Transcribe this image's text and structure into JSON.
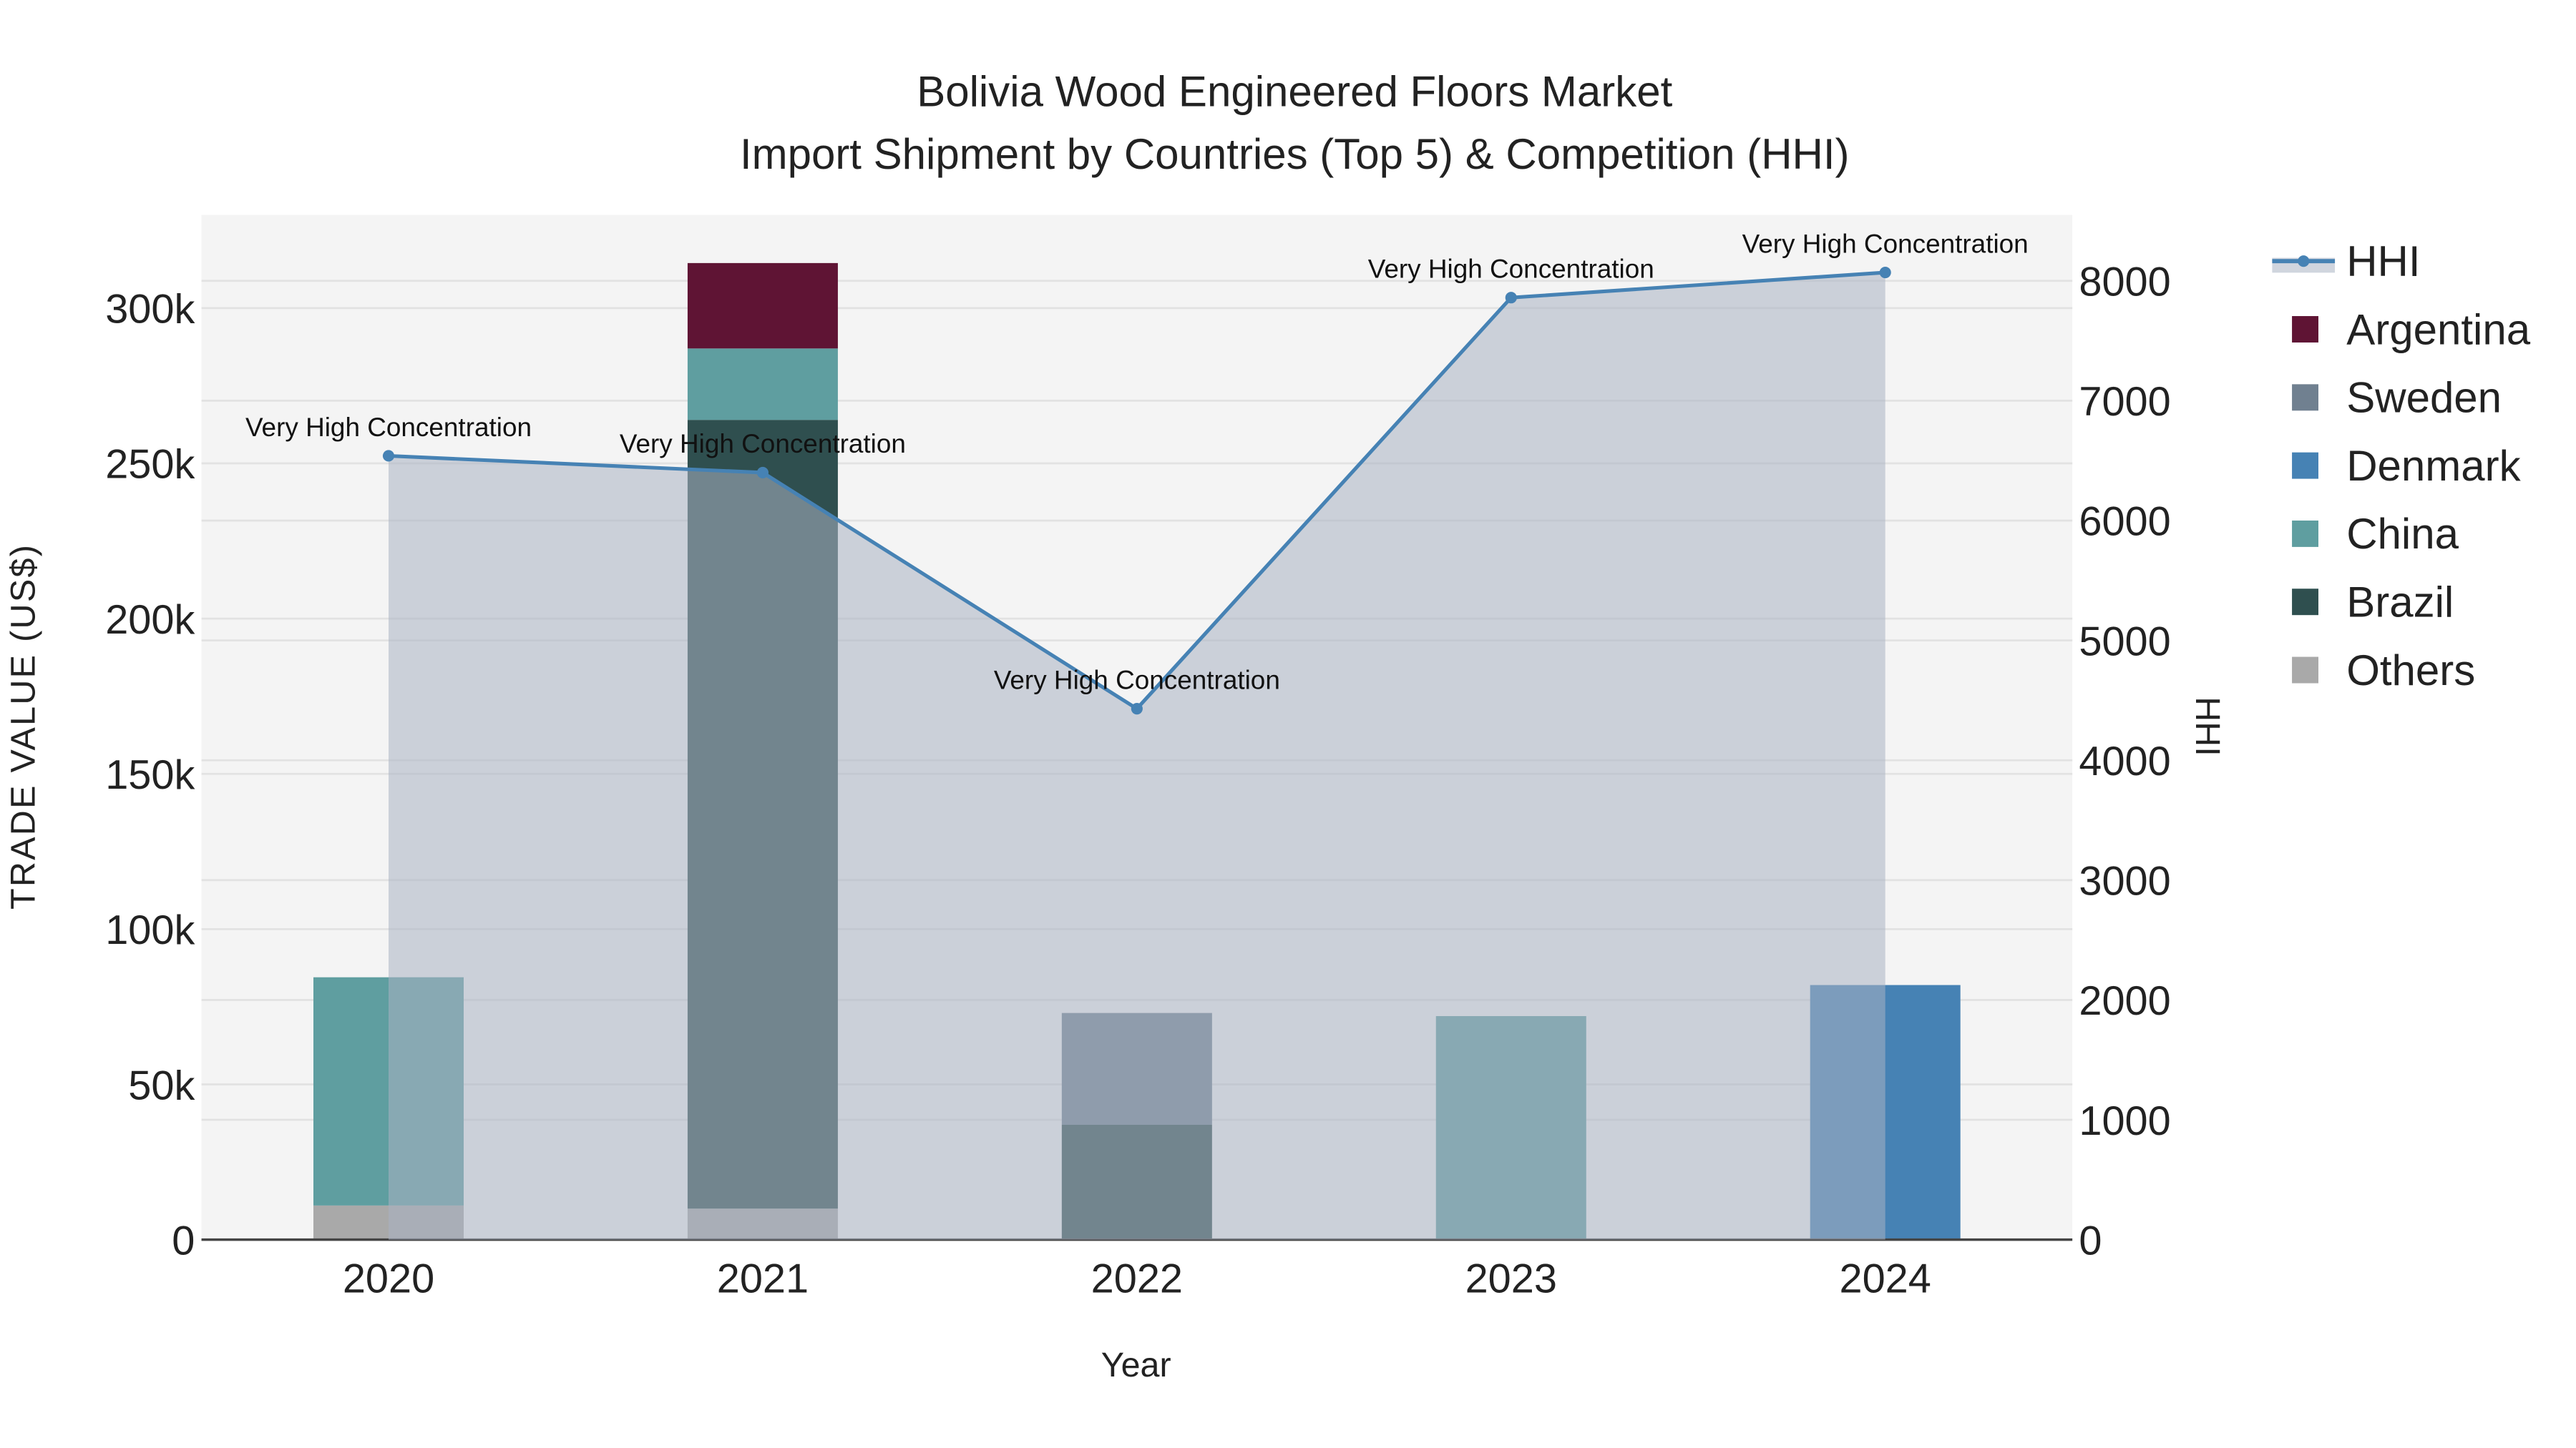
{
  "chart_data": {
    "type": "bar",
    "title": "Bolivia Wood Engineered Floors Market",
    "subtitle": "Import Shipment by Countries (Top 5) & Competition (HHI)",
    "xlabel": "Year",
    "ylabel": "TRADE VALUE (US$)",
    "y2label": "HHI",
    "categories": [
      "2020",
      "2021",
      "2022",
      "2023",
      "2024"
    ],
    "ylim": [
      0,
      330000
    ],
    "y2lim": [
      0,
      8550
    ],
    "yticks": [
      0,
      50000,
      100000,
      150000,
      200000,
      250000,
      300000
    ],
    "ytick_labels": [
      "0",
      "50k",
      "100k",
      "150k",
      "200k",
      "250k",
      "300k"
    ],
    "y2ticks": [
      0,
      1000,
      2000,
      3000,
      4000,
      5000,
      6000,
      7000,
      8000
    ],
    "y2tick_labels": [
      "0",
      "1000",
      "2000",
      "3000",
      "4000",
      "5000",
      "6000",
      "7000",
      "8000"
    ],
    "grid": true,
    "legend_position": "right",
    "series": [
      {
        "name": "Others",
        "color": "#a9a9a9",
        "values": [
          11000,
          10000,
          0,
          0,
          0
        ]
      },
      {
        "name": "Brazil",
        "color": "#2f4f4f",
        "values": [
          0,
          254000,
          37000,
          0,
          0
        ]
      },
      {
        "name": "China",
        "color": "#5f9ea0",
        "values": [
          73500,
          23000,
          0,
          72000,
          0
        ]
      },
      {
        "name": "Denmark",
        "color": "#4682b4",
        "values": [
          0,
          0,
          0,
          0,
          82000
        ]
      },
      {
        "name": "Sweden",
        "color": "#708090",
        "values": [
          0,
          0,
          36000,
          0,
          0
        ]
      },
      {
        "name": "Argentina",
        "color": "#5f1434",
        "values": [
          0,
          27500,
          0,
          0,
          0
        ]
      }
    ],
    "hhi": {
      "name": "HHI",
      "color": "#4682b4",
      "values": [
        6540,
        6400,
        4430,
        7860,
        8070
      ],
      "annotations": [
        "Very High Concentration",
        "Very High Concentration",
        "Very High Concentration",
        "Very High Concentration",
        "Very High Concentration"
      ]
    },
    "legend_order": [
      "HHI",
      "Argentina",
      "Sweden",
      "Denmark",
      "China",
      "Brazil",
      "Others"
    ]
  }
}
